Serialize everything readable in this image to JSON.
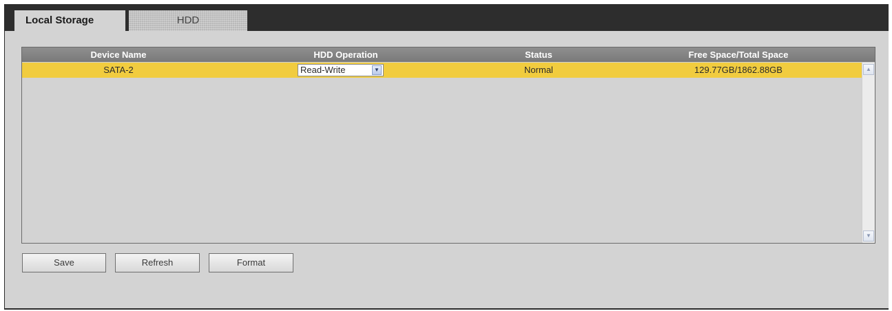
{
  "tabs": [
    {
      "label": "Local Storage",
      "active": true
    },
    {
      "label": "HDD",
      "active": false
    }
  ],
  "table": {
    "headers": [
      "Device Name",
      "HDD Operation",
      "Status",
      "Free Space/Total Space"
    ],
    "rows": [
      {
        "device": "SATA-2",
        "operation": "Read-Write",
        "status": "Normal",
        "space": "129.77GB/1862.88GB"
      }
    ],
    "selected_row_color": "#f1cc3f"
  },
  "buttons": {
    "save": "Save",
    "refresh": "Refresh",
    "format": "Format"
  },
  "icons": {
    "select_arrow": "chevron-down-icon",
    "scroll_up": "chevron-up-icon",
    "scroll_down": "chevron-down-icon"
  }
}
